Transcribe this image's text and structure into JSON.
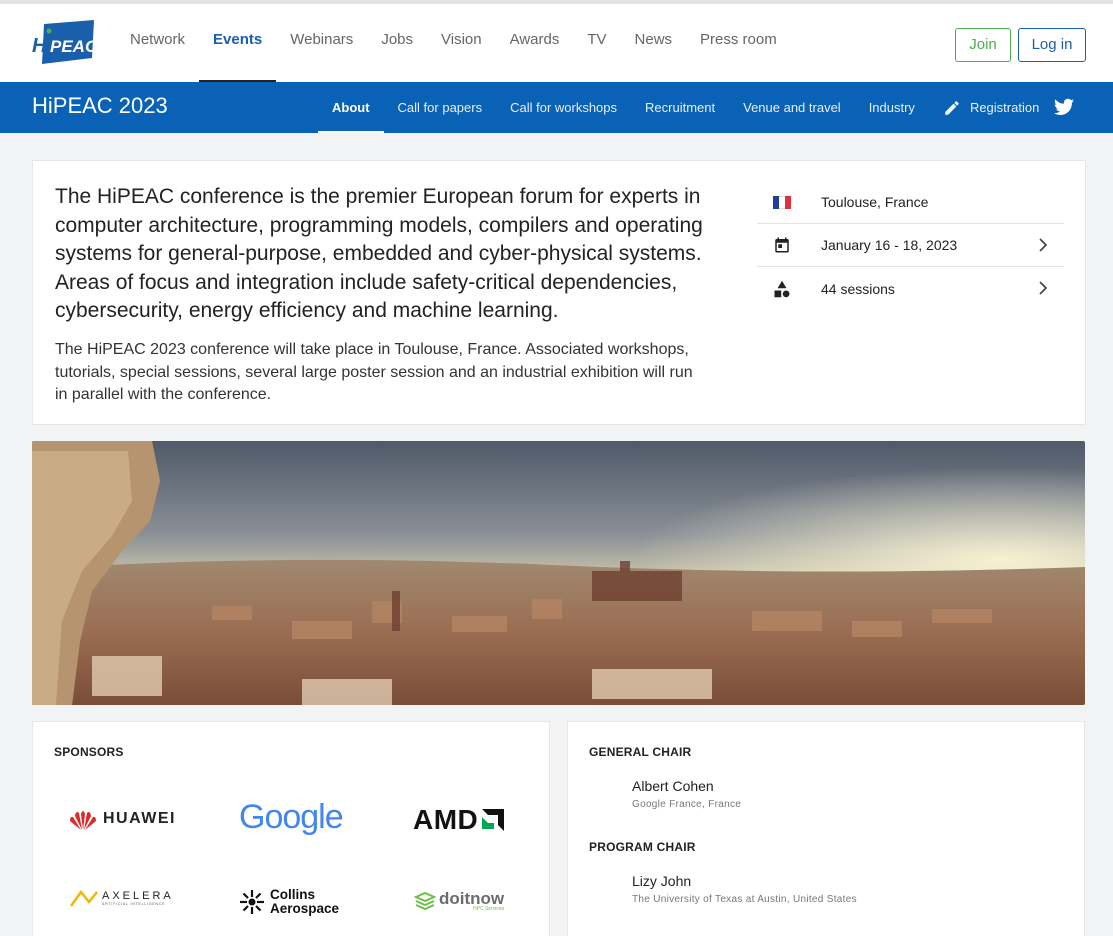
{
  "brand": {
    "logo_text": "HiPEAC"
  },
  "nav": {
    "links": [
      "Network",
      "Events",
      "Webinars",
      "Jobs",
      "Vision",
      "Awards",
      "TV",
      "News",
      "Press room"
    ],
    "active": "Events",
    "join_label": "Join",
    "login_label": "Log in"
  },
  "event": {
    "title": "HiPEAC 2023",
    "tabs": [
      "About",
      "Call for papers",
      "Call for workshops",
      "Recruitment",
      "Venue and travel",
      "Industry",
      "Registration"
    ],
    "active_tab": "About"
  },
  "intro": {
    "lead": "The HiPEAC conference is the premier European forum for experts in computer architecture, programming models, compilers and operating systems for general-purpose, embedded and cyber-physical systems. Areas of focus and integration include safety-critical dependencies, cybersecurity, energy efficiency and machine learning.",
    "description": "The HiPEAC 2023 conference will take place in Toulouse, France. Associated workshops, tutorials, special sessions, several large poster session and an industrial exhibition will run in parallel with the conference.",
    "facts": {
      "location": "Toulouse, France",
      "dates": "January 16 - 18, 2023",
      "sessions": "44 sessions"
    }
  },
  "sponsors": {
    "heading": "SPONSORS",
    "logos": {
      "huawei": "HUAWEI",
      "google": "Google",
      "amd": "AMD",
      "axelera": "AXELERA",
      "axelera_sub": "ARTIFICIAL INTELLIGENCE",
      "collins_1": "Collins",
      "collins_2": "Aerospace",
      "doitnow": "doitnow",
      "doitnow_sub": "HPC Services"
    }
  },
  "chairs": {
    "general_heading": "GENERAL CHAIR",
    "general_name": "Albert Cohen",
    "general_affiliation": "Google France, France",
    "program_heading": "PROGRAM CHAIR",
    "program_name": "Lizy John",
    "program_affiliation": "The University of Texas at Austin, United States"
  },
  "colors": {
    "brand_blue": "#0a62b7",
    "join_green": "#4cae4c",
    "link_blue": "#1a5fab"
  }
}
